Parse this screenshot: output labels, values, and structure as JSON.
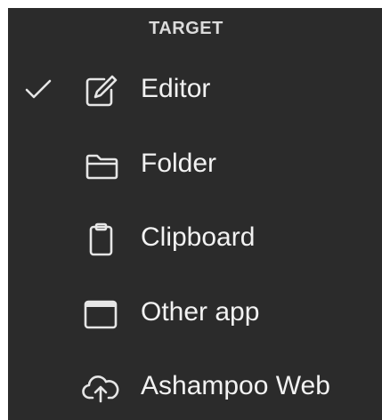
{
  "menu": {
    "header": "TARGET",
    "items": [
      {
        "id": "editor",
        "label": "Editor",
        "icon": "edit-icon",
        "checked": true
      },
      {
        "id": "folder",
        "label": "Folder",
        "icon": "folder-icon",
        "checked": false
      },
      {
        "id": "clipboard",
        "label": "Clipboard",
        "icon": "clipboard-icon",
        "checked": false
      },
      {
        "id": "other-app",
        "label": "Other app",
        "icon": "window-icon",
        "checked": false
      },
      {
        "id": "ashampoo-web",
        "label": "Ashampoo Web",
        "icon": "cloud-upload-icon",
        "checked": false
      }
    ]
  },
  "colors": {
    "background": "#2b2b2b",
    "text": "#f2f2f2",
    "header_text": "#dcdcdc"
  }
}
